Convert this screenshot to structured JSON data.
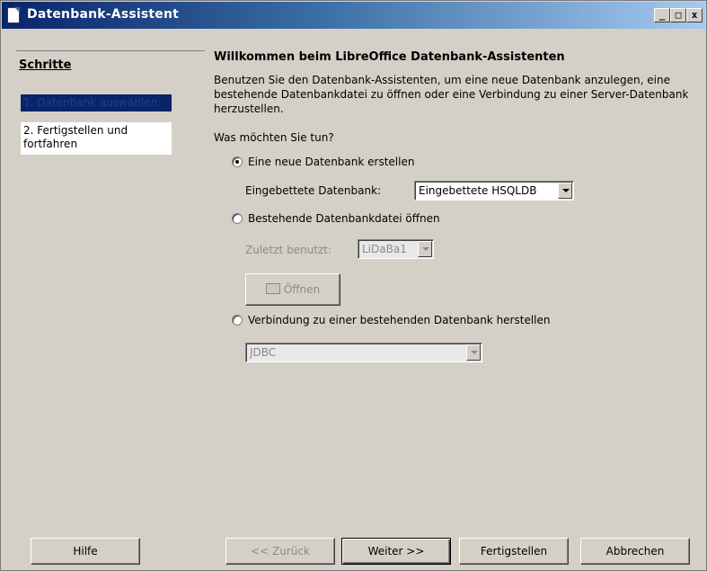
{
  "window": {
    "title": "Datenbank-Assistent"
  },
  "sidebar": {
    "title": "Schritte",
    "steps": [
      {
        "label": "1. Datenbank auswählen"
      },
      {
        "label": "2. Fertigstellen und\n    fortfahren"
      }
    ]
  },
  "main": {
    "heading": "Willkommen beim LibreOffice Datenbank-Assistenten",
    "intro": "Benutzen Sie den Datenbank-Assistenten, um eine neue Datenbank anzulegen, eine bestehende Datenbankdatei zu öffnen oder eine Verbindung zu einer Server-Datenbank herzustellen.",
    "question": "Was möchten Sie tun?",
    "options": {
      "new_db": {
        "label": "Eine neue Datenbank erstellen",
        "checked": true
      },
      "embedded_label": "Eingebettete Datenbank:",
      "embedded_value": "Eingebettete HSQLDB",
      "existing_file": {
        "label": "Bestehende Datenbankdatei öffnen",
        "checked": false
      },
      "recent_label": "Zuletzt benutzt:",
      "recent_value": "LiDaBa1",
      "open_button": "Öffnen",
      "connect": {
        "label": "Verbindung zu einer bestehenden Datenbank herstellen",
        "checked": false
      },
      "connect_value": "JDBC"
    }
  },
  "buttons": {
    "help": "Hilfe",
    "back": "<< Zurück",
    "next": "Weiter >>",
    "finish": "Fertigstellen",
    "cancel": "Abbrechen"
  }
}
